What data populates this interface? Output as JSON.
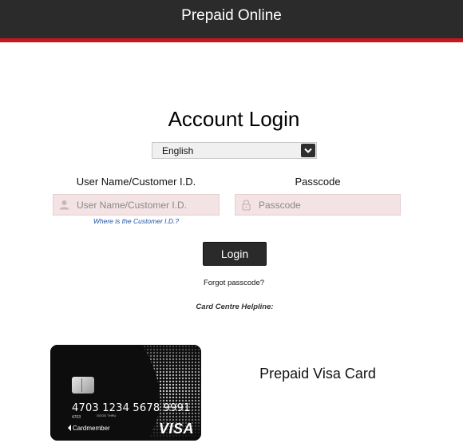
{
  "header": {
    "title": "Prepaid Online"
  },
  "login": {
    "title": "Account Login",
    "language": {
      "selected": "English"
    },
    "user_label": "User Name/Customer I.D.",
    "user_placeholder": "User Name/Customer I.D.",
    "user_value": "",
    "custid_help_link": "Where is the Customer I.D.?",
    "pass_label": "Passcode",
    "pass_placeholder": "Passcode",
    "pass_value": "",
    "login_button": "Login",
    "forgot_link": "Forgot passcode?",
    "helpline_label": "Card Centre Helpline:"
  },
  "card": {
    "number": "4703 1234 5678 9991",
    "small_number": "4703",
    "valid_text": "GOOD THRU",
    "holder": "Cardmember",
    "network": "VISA",
    "caption": "Prepaid Visa Card"
  },
  "colors": {
    "header_bg": "#2b2b2b",
    "accent_red": "#c8161d",
    "input_bg": "#f3e3e4",
    "link_blue": "#2154a6",
    "button_bg": "#2a2a2a"
  },
  "icons": {
    "user_field": "user-icon",
    "pass_field": "lock-icon",
    "language_dropdown": "chevron-down-icon"
  }
}
